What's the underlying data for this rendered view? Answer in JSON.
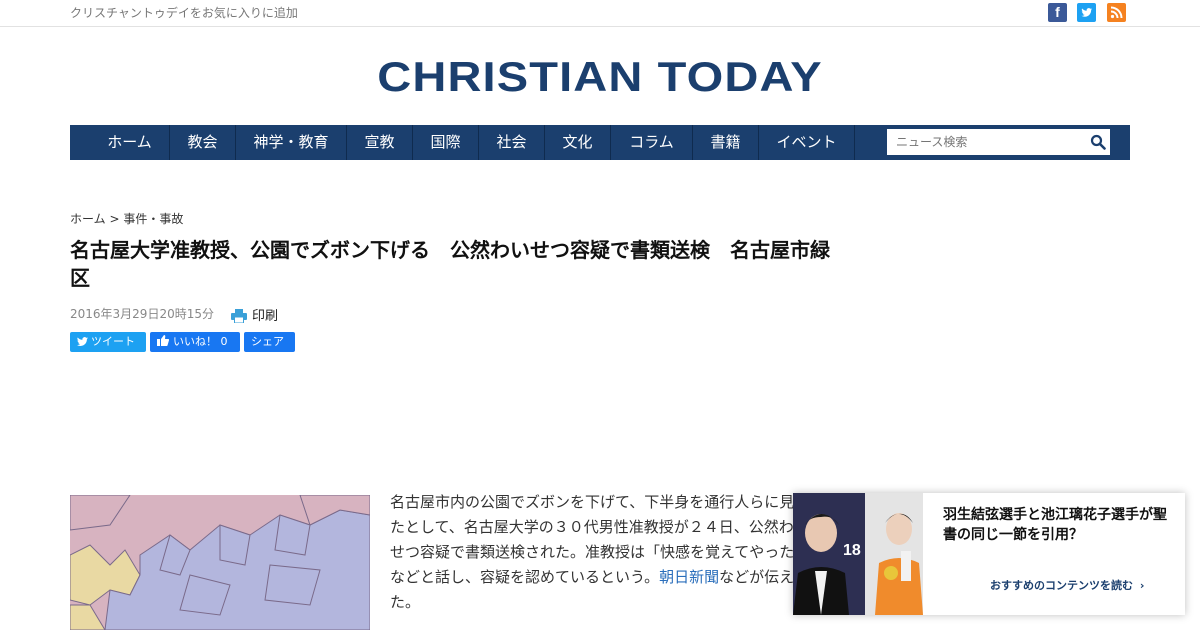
{
  "topbar": {
    "favorite_text": "クリスチャントゥデイをお気に入りに追加"
  },
  "social": {
    "facebook": "f",
    "twitter": "t",
    "rss": "rss"
  },
  "logo": {
    "text": "CHRISTIAN TODAY"
  },
  "nav": {
    "items": [
      "ホーム",
      "教会",
      "神学・教育",
      "宣教",
      "国際",
      "社会",
      "文化",
      "コラム",
      "書籍",
      "イベント"
    ],
    "search_placeholder": "ニュース検索"
  },
  "article": {
    "breadcrumb": "ホーム > 事件・事故",
    "title": "名古屋大学准教授、公園でズボン下げる　公然わいせつ容疑で書類送検　名古屋市緑区",
    "date": "2016年3月29日20時15分",
    "print_label": "印刷",
    "share": {
      "tweet": "ツイート",
      "like": "いいね！ 0",
      "share": "シェア"
    },
    "body_before_link": "名古屋市内の公園でズボンを下げて、下半身を通行人らに見せたとして、名古屋大学の３０代男性准教授が２４日、公然わいせつ容疑で書類送検された。准教授は「快感を覚えてやった」などと話し、容疑を認めているという。",
    "body_link": "朝日新聞",
    "body_after_link": "などが伝えた。"
  },
  "recommend": {
    "title": "羽生結弦選手と池江璃花子選手が聖書の同じ一節を引用？",
    "link": "おすすめのコンテンツを読む",
    "photo_text": "18"
  },
  "colors": {
    "brand": "#1b3f6e",
    "link": "#2a6ebb",
    "twitter": "#1da1f2",
    "facebook": "#1877f2"
  }
}
